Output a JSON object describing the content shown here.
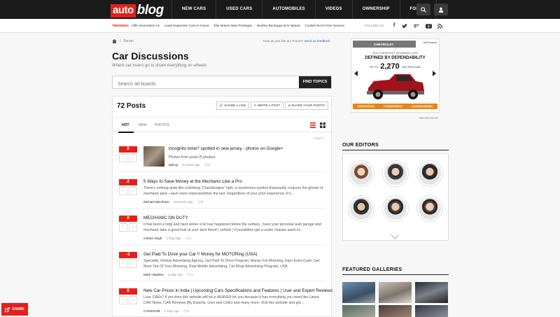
{
  "header": {
    "logo_auto": "auto",
    "logo_blog": "blog",
    "nav": [
      "NEW CARS",
      "USED CARS",
      "AUTOMOBILES",
      "VIDEOS",
      "OWNERSHIP",
      "FORUM"
    ]
  },
  "trending": {
    "label": "TRENDING",
    "items": [
      "Fifth-Generation A4",
      "Least Expensive Cars to Insure",
      "Elio Motors New Prototype",
      "Bentley Bentayga SUV Speed",
      "Coolest SUVs from Geneva"
    ],
    "follow_label": "FOLLOW US"
  },
  "breadcrumb": {
    "current": "Forum"
  },
  "feedback": {
    "question": "How do you like our Forum?",
    "link": "Send us feedback"
  },
  "page": {
    "title": "Car Discussions",
    "subtitle": "Where car lovers go to share everything on wheels"
  },
  "search": {
    "placeholder": "Search all boards",
    "button": "FIND TOPICS"
  },
  "posts_panel": {
    "count_label": "72 Posts",
    "actions": [
      "SHARE A LINK",
      "WRITE A POST",
      "SHARE YOUR PHOTO"
    ],
    "tabs": [
      "HOT",
      "NEW",
      "PHOTOS"
    ],
    "page_label": "Page 1"
  },
  "posts": [
    {
      "score": "0",
      "title": "incognito bmw? spotted in new jersey - photos on Google+",
      "excerpt": "Photos from posts (5 photos)",
      "author": "bplcxp",
      "time": "3 Hours Ago",
      "comments": "0"
    },
    {
      "score": "2",
      "title": "5 Ways to Save Money at the Mechanic Like a Pro",
      "excerpt": "There's nothing quite like a blinking \"CheckEngine\" light, a mysterious symbol thatusually conjures the ghosts of mechanic past—each more expensivethan the last. Regardless of your prior experience, it's...",
      "author": "Michael Mechanic",
      "time": "18 Hours Ago",
      "comments": "3"
    },
    {
      "score": "0",
      "title": "MECHANIC ON DUTY",
      "excerpt": "It has been a long and hard winter a lot has happened below the surface , have your personal auto garage and mechanic take a good look at your best friend ( vehicle ) if possiblbre get a under chassis wash to...",
      "author": "mohan singh",
      "time": "1 Day Ago",
      "comments": "2"
    },
    {
      "score": "-1",
      "title": "Get Paid To Drive your Car !! Money for MOTORing (USA)",
      "excerpt": "Speciality Vehicle Advertising Agency, Get Paid To Drive Program, Money For Motoring, Earn Extra Cash, Get More Out Of Your Motoring, Real Mobile Advertising, Car Wrap Advertising Program, USA",
      "author": "Mark Hawkins",
      "time": "1 Day Ago",
      "comments": "1"
    },
    {
      "score": "0",
      "title": "New Car Prices in India | Upcoming Cars Specifications and Features | User and Expert Reviews",
      "excerpt": "Love CARs? If yes then this website will be a HEAVEN for you because it has everything you need like Latest CAR News, CAR Reviews (By Experts, User and Critic) and many more. Visit this website and get...",
      "author": "CARZOOM",
      "time": "1 Day Ago",
      "comments": "0"
    }
  ],
  "ad": {
    "brand": "CHEVROLET",
    "adchoices": "AdChoices",
    "model": "2015 CHEVROLET SILVERADO 1500",
    "headline": "DEFINED BY DEPENDABILITY",
    "upto": "UP TO",
    "payload": "2,270",
    "payload_unit": "LBS PAYLOAD",
    "buttons": [
      "Build & Price",
      "Current Offers",
      "Locate A Vehicle"
    ],
    "label": "Advertisement",
    "colors": {
      "red_truck": "#a3121a",
      "orange_bar": "#e5831d"
    }
  },
  "sidebar": {
    "editors_title": "OUR EDITORS",
    "galleries_title": "FEATURED GALLERIES"
  },
  "share": {
    "label": "SHARE"
  },
  "colors": {
    "brand_red": "#e3211c",
    "nav_bg": "#1a1a1a"
  }
}
